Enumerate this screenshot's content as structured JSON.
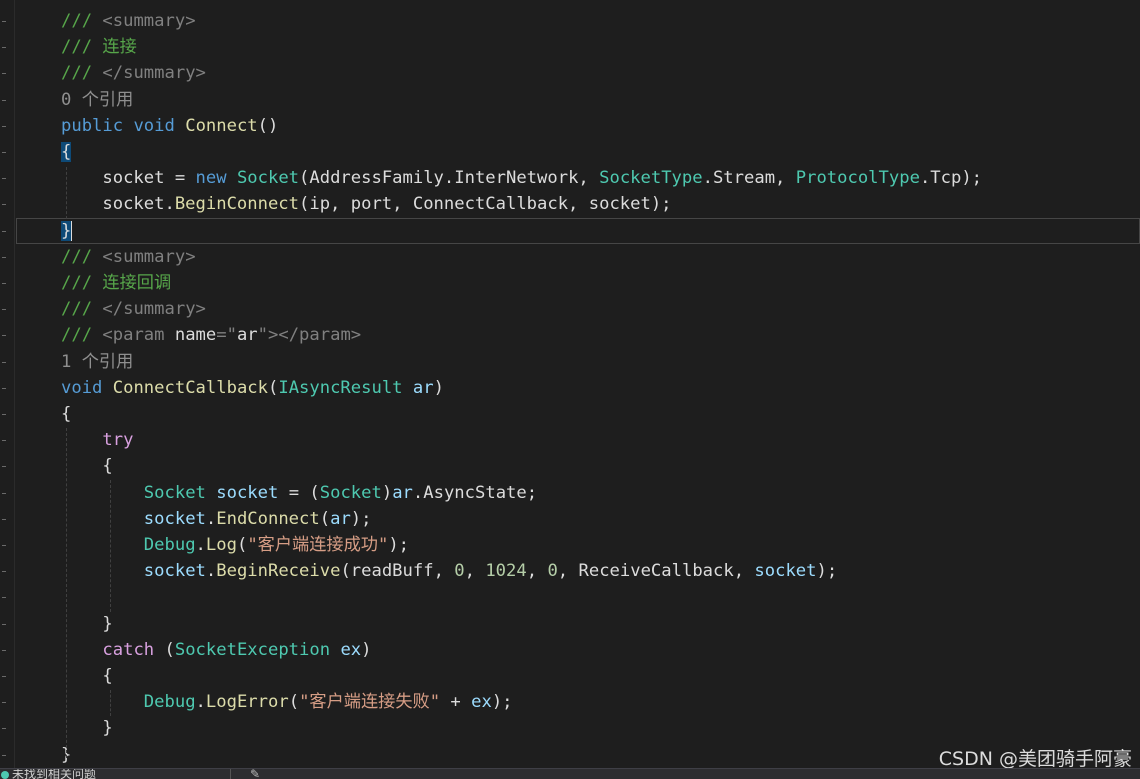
{
  "code_lines": [
    [
      [
        "/// ",
        "comment"
      ],
      [
        "<summary>",
        "tag"
      ]
    ],
    [
      [
        "/// 连接",
        "comment"
      ]
    ],
    [
      [
        "/// ",
        "comment"
      ],
      [
        "</summary>",
        "tag"
      ]
    ],
    [
      [
        "0 个引用",
        "ref"
      ]
    ],
    [
      [
        "public",
        "kw"
      ],
      [
        " ",
        "plain"
      ],
      [
        "void",
        "kw"
      ],
      [
        " ",
        "plain"
      ],
      [
        "Connect",
        "method"
      ],
      [
        "()",
        "plain"
      ]
    ],
    [
      [
        "{",
        "brace-hl"
      ]
    ],
    [
      [
        "    socket = ",
        "plain"
      ],
      [
        "new",
        "kw"
      ],
      [
        " ",
        "plain"
      ],
      [
        "Socket",
        "type"
      ],
      [
        "(AddressFamily.InterNetwork, ",
        "plain"
      ],
      [
        "SocketType",
        "type"
      ],
      [
        ".Stream, ",
        "plain"
      ],
      [
        "ProtocolType",
        "type"
      ],
      [
        ".Tcp);",
        "plain"
      ]
    ],
    [
      [
        "    socket.",
        "plain"
      ],
      [
        "BeginConnect",
        "method"
      ],
      [
        "(ip, port, ConnectCallback, socket);",
        "plain"
      ]
    ],
    [
      [
        "}",
        "brace-hl"
      ]
    ],
    [
      [
        "/// ",
        "comment"
      ],
      [
        "<summary>",
        "tag"
      ]
    ],
    [
      [
        "/// 连接回调",
        "comment"
      ]
    ],
    [
      [
        "/// ",
        "comment"
      ],
      [
        "</summary>",
        "tag"
      ]
    ],
    [
      [
        "/// ",
        "comment"
      ],
      [
        "<param ",
        "tag"
      ],
      [
        "name",
        "plain"
      ],
      [
        "=\"",
        "tag"
      ],
      [
        "ar",
        "plain"
      ],
      [
        "\"></param>",
        "tag"
      ]
    ],
    [
      [
        "1 个引用",
        "ref"
      ]
    ],
    [
      [
        "void",
        "kw"
      ],
      [
        " ",
        "plain"
      ],
      [
        "ConnectCallback",
        "method"
      ],
      [
        "(",
        "plain"
      ],
      [
        "IAsyncResult",
        "type"
      ],
      [
        " ",
        "plain"
      ],
      [
        "ar",
        "var"
      ],
      [
        ")",
        "plain"
      ]
    ],
    [
      [
        "{",
        "plain"
      ]
    ],
    [
      [
        "    ",
        "plain"
      ],
      [
        "try",
        "ctrl"
      ]
    ],
    [
      [
        "    {",
        "plain"
      ]
    ],
    [
      [
        "        ",
        "plain"
      ],
      [
        "Socket",
        "type"
      ],
      [
        " ",
        "plain"
      ],
      [
        "socket",
        "var"
      ],
      [
        " = (",
        "plain"
      ],
      [
        "Socket",
        "type"
      ],
      [
        ")",
        "plain"
      ],
      [
        "ar",
        "var"
      ],
      [
        ".AsyncState;",
        "plain"
      ]
    ],
    [
      [
        "        ",
        "plain"
      ],
      [
        "socket",
        "var"
      ],
      [
        ".",
        "plain"
      ],
      [
        "EndConnect",
        "method"
      ],
      [
        "(",
        "plain"
      ],
      [
        "ar",
        "var"
      ],
      [
        ");",
        "plain"
      ]
    ],
    [
      [
        "        ",
        "plain"
      ],
      [
        "Debug",
        "type"
      ],
      [
        ".",
        "plain"
      ],
      [
        "Log",
        "method"
      ],
      [
        "(",
        "plain"
      ],
      [
        "\"客户端连接成功\"",
        "str"
      ],
      [
        ");",
        "plain"
      ]
    ],
    [
      [
        "        ",
        "plain"
      ],
      [
        "socket",
        "var"
      ],
      [
        ".",
        "plain"
      ],
      [
        "BeginReceive",
        "method"
      ],
      [
        "(readBuff, ",
        "plain"
      ],
      [
        "0",
        "num"
      ],
      [
        ", ",
        "plain"
      ],
      [
        "1024",
        "num"
      ],
      [
        ", ",
        "plain"
      ],
      [
        "0",
        "num"
      ],
      [
        ", ReceiveCallback, ",
        "plain"
      ],
      [
        "socket",
        "var"
      ],
      [
        ");",
        "plain"
      ]
    ],
    [
      [
        "",
        "plain"
      ]
    ],
    [
      [
        "    }",
        "plain"
      ]
    ],
    [
      [
        "    ",
        "plain"
      ],
      [
        "catch",
        "ctrl"
      ],
      [
        " (",
        "plain"
      ],
      [
        "SocketException",
        "type"
      ],
      [
        " ",
        "plain"
      ],
      [
        "ex",
        "var"
      ],
      [
        ")",
        "plain"
      ]
    ],
    [
      [
        "    {",
        "plain"
      ]
    ],
    [
      [
        "        ",
        "plain"
      ],
      [
        "Debug",
        "type"
      ],
      [
        ".",
        "plain"
      ],
      [
        "LogError",
        "method"
      ],
      [
        "(",
        "plain"
      ],
      [
        "\"客户端连接失败\"",
        "str"
      ],
      [
        " + ",
        "plain"
      ],
      [
        "ex",
        "var"
      ],
      [
        ");",
        "plain"
      ]
    ],
    [
      [
        "    }",
        "plain"
      ]
    ],
    [
      [
        "}",
        "plain"
      ]
    ]
  ],
  "watermark": "CSDN @美团骑手阿豪",
  "statusbar": {
    "text": "未找到相关问题"
  }
}
